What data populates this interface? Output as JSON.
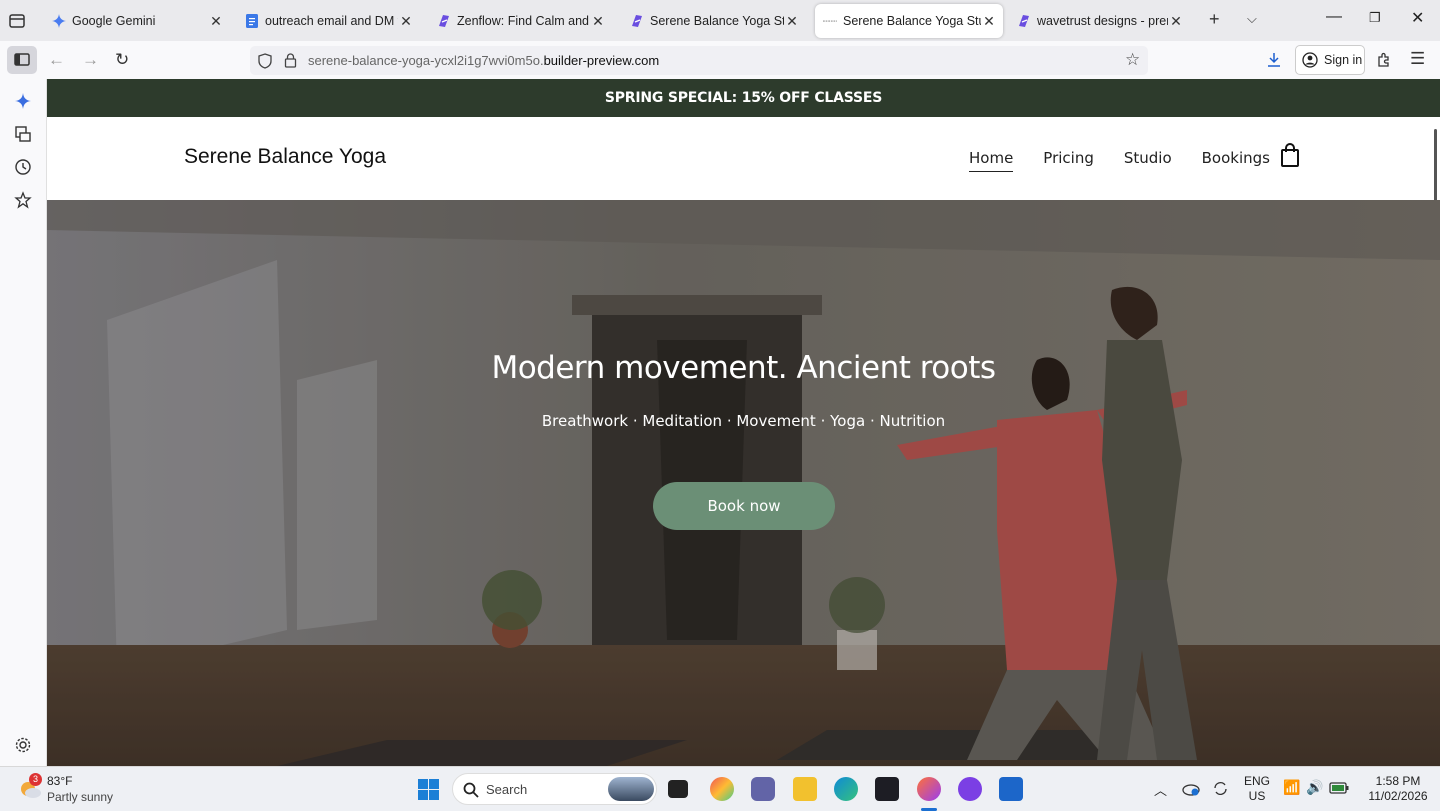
{
  "browser": {
    "tabs": [
      {
        "title": "Google Gemini",
        "icon": "gemini-icon"
      },
      {
        "title": "outreach email and DM tem",
        "icon": "docs-icon"
      },
      {
        "title": "Zenflow: Find Calm and Stre",
        "icon": "builder-icon"
      },
      {
        "title": "Serene Balance Yoga Studio",
        "icon": "builder-icon"
      },
      {
        "title": "Serene Balance Yoga Studio",
        "icon": "loading-icon",
        "active": true
      },
      {
        "title": "wavetrust designs - premiun",
        "icon": "builder-icon"
      }
    ],
    "url_prefix": "serene-balance-yoga-ycxl2i1g7wvi0m5o.",
    "url_domain": "builder-preview.com",
    "sign_in": "Sign in"
  },
  "site": {
    "promo": "SPRING SPECIAL: 15% OFF CLASSES",
    "brand": "Serene Balance Yoga",
    "nav": [
      "Home",
      "Pricing",
      "Studio",
      "Bookings"
    ],
    "hero_title": "Modern movement. Ancient roots",
    "hero_subtitle": "Breathwork · Meditation · Movement  · Yoga  · Nutrition",
    "cta": "Book now"
  },
  "taskbar": {
    "weather_temp": "83°F",
    "weather_desc": "Partly sunny",
    "weather_badge": "3",
    "search": "Search",
    "lang1": "ENG",
    "lang2": "US",
    "time": "1:58 PM",
    "date": "11/02/2026"
  },
  "colors": {
    "promo_bg": "#2d3b2c",
    "cta_bg": "#6b8f76"
  }
}
